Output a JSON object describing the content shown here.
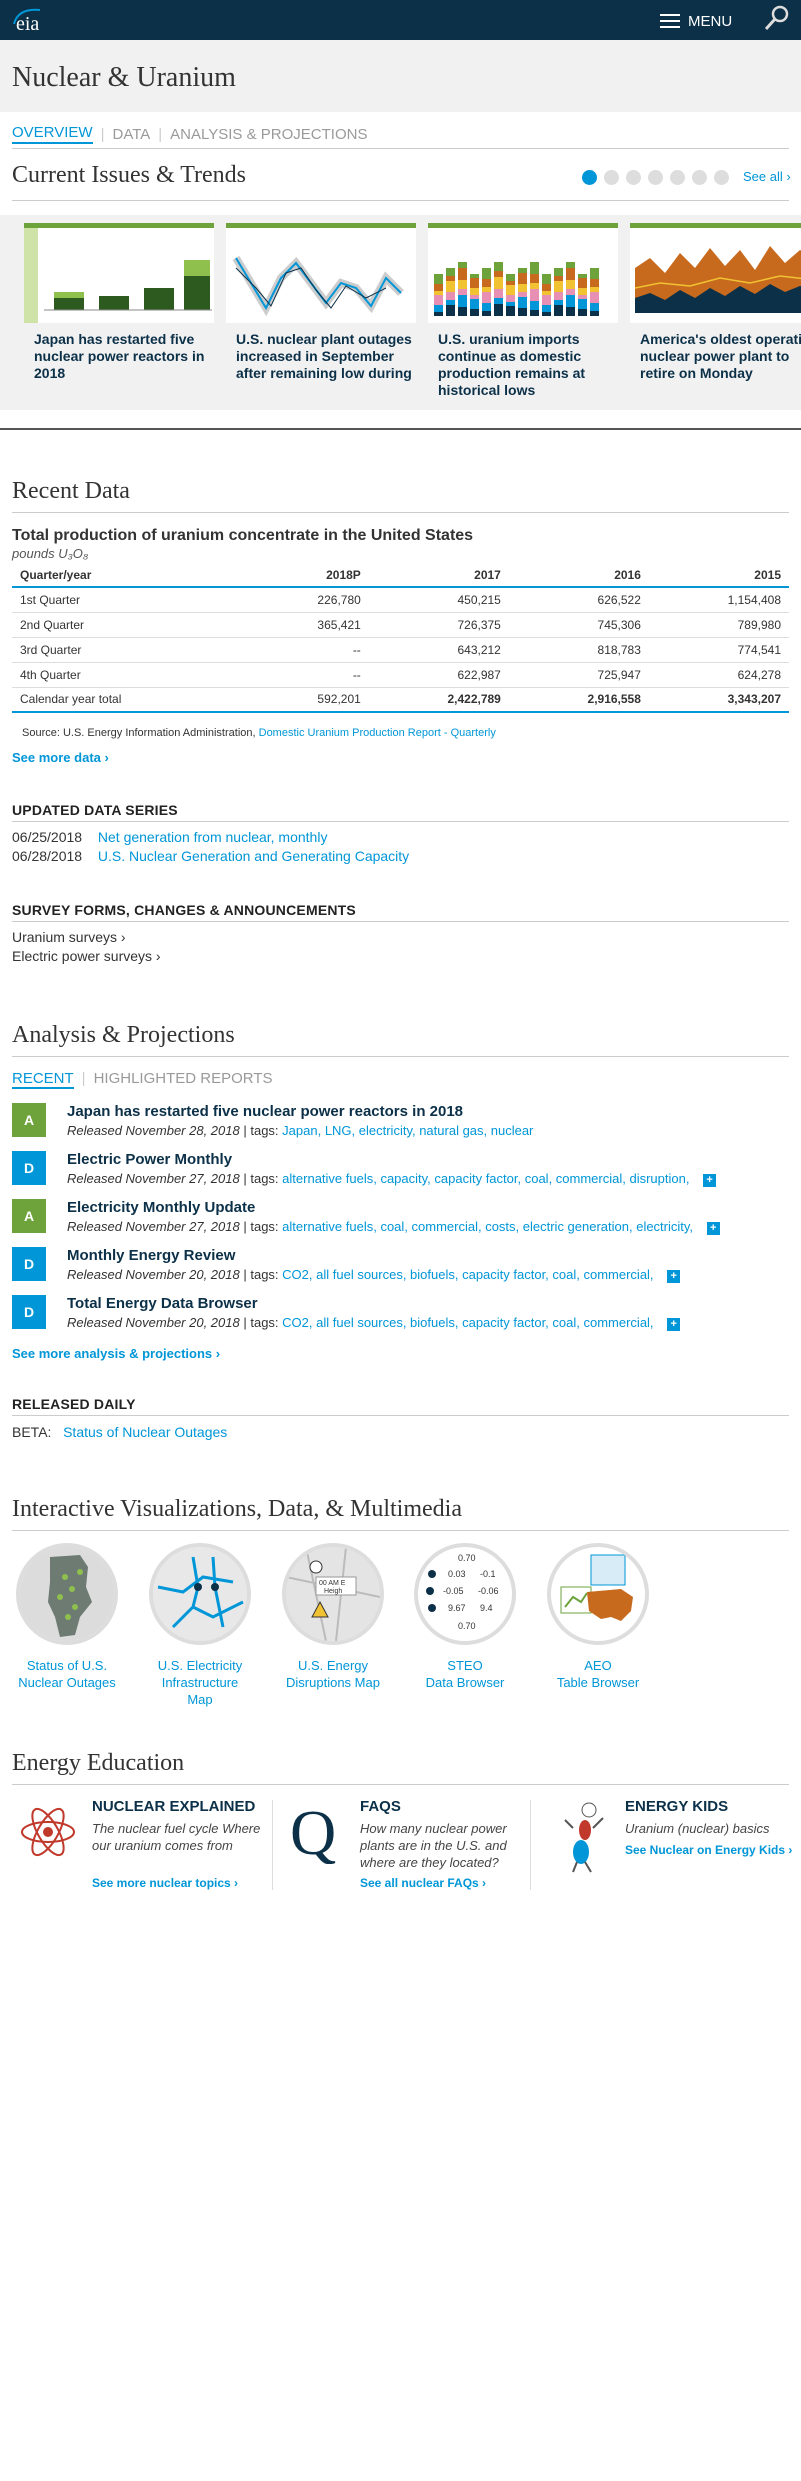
{
  "header": {
    "logo_text": "eia",
    "menu_label": "MENU"
  },
  "page_title": "Nuclear & Uranium",
  "subnav": {
    "overview": "OVERVIEW",
    "data": "DATA",
    "analysis": "ANALYSIS & PROJECTIONS"
  },
  "trends": {
    "title": "Current Issues & Trends",
    "see_all": "See all ›",
    "cards": [
      {
        "caption": "Japan has restarted five nuclear power reactors in 2018"
      },
      {
        "caption": "U.S. nuclear plant outages increased in September after remaining low during"
      },
      {
        "caption": "U.S. uranium imports continue as domestic production remains at historical lows"
      },
      {
        "caption": "America's oldest operating nuclear power plant to retire on Monday"
      }
    ]
  },
  "recent_data": {
    "title": "Recent Data",
    "table_title": "Total production of uranium concentrate in the United States",
    "unit": "pounds U₃O₈",
    "columns": [
      "Quarter/year",
      "2018P",
      "2017",
      "2016",
      "2015"
    ],
    "rows": [
      [
        "1st Quarter",
        "226,780",
        "450,215",
        "626,522",
        "1,154,408"
      ],
      [
        "2nd Quarter",
        "365,421",
        "726,375",
        "745,306",
        "789,980"
      ],
      [
        "3rd Quarter",
        "--",
        "643,212",
        "818,783",
        "774,541"
      ],
      [
        "4th Quarter",
        "--",
        "622,987",
        "725,947",
        "624,278"
      ],
      [
        "Calendar year total",
        "592,201",
        "2,422,789",
        "2,916,558",
        "3,343,207"
      ]
    ],
    "source_prefix": "Source: U.S. Energy Information Administration,",
    "source_link": "Domestic Uranium Production Report - Quarterly",
    "see_more": "See more data ›"
  },
  "updated_series": {
    "title": "UPDATED DATA SERIES",
    "items": [
      {
        "date": "06/25/2018",
        "label": "Net generation from nuclear, monthly"
      },
      {
        "date": "06/28/2018",
        "label": "U.S. Nuclear Generation and Generating Capacity"
      }
    ]
  },
  "survey": {
    "title": "SURVEY FORMS, CHANGES & ANNOUNCEMENTS",
    "items": [
      "Uranium surveys ›",
      "Electric power surveys ›"
    ]
  },
  "analysis": {
    "title": "Analysis & Projections",
    "tab_recent": "RECENT",
    "tab_highlighted": "HIGHLIGHTED REPORTS",
    "reports": [
      {
        "badge": "A",
        "title": "Japan has restarted five nuclear power reactors in 2018",
        "released": "Released November 28, 2018",
        "tags": "Japan, LNG, electricity, natural gas, nuclear",
        "plus": ""
      },
      {
        "badge": "D",
        "title": "Electric Power Monthly",
        "released": "Released November 27, 2018",
        "tags": "alternative fuels, capacity, capacity factor, coal, commercial, disruption,",
        "plus": "+"
      },
      {
        "badge": "A",
        "title": "Electricity Monthly Update",
        "released": "Released November 27, 2018",
        "tags": "alternative fuels, coal, commercial, costs, electric generation, electricity,",
        "plus": "+"
      },
      {
        "badge": "D",
        "title": "Monthly Energy Review",
        "released": "Released November 20, 2018",
        "tags": "CO2, all fuel sources, biofuels, capacity factor, coal, commercial,",
        "plus": "+"
      },
      {
        "badge": "D",
        "title": "Total Energy Data Browser",
        "released": "Released November 20, 2018",
        "tags": "CO2, all fuel sources, biofuels, capacity factor, coal, commercial,",
        "plus": "+"
      }
    ],
    "tags_prefix": "| tags:",
    "see_more": "See more analysis & projections ›"
  },
  "released_daily": {
    "title": "RELEASED DAILY",
    "beta": "BETA:",
    "link": "Status of Nuclear Outages"
  },
  "visualizations": {
    "title": "Interactive Visualizations, Data, & Multimedia",
    "items": [
      {
        "line1": "Status of U.S.",
        "line2": "Nuclear Outages",
        "line3": ""
      },
      {
        "line1": "U.S. Electricity",
        "line2": "Infrastructure",
        "line3": "Map"
      },
      {
        "line1": "U.S. Energy",
        "line2": "Disruptions Map",
        "line3": ""
      },
      {
        "line1": "STEO",
        "line2": "Data Browser",
        "line3": ""
      },
      {
        "line1": "AEO",
        "line2": "Table Browser",
        "line3": ""
      }
    ],
    "steo_values": [
      "0.70",
      "0.03",
      "-0.1",
      "-0.05",
      "-0.06",
      "9.67",
      "9.4",
      "0.70"
    ],
    "disruption_text": "00 AM E",
    "disruption_sub": "Heigh"
  },
  "education": {
    "title": "Energy Education",
    "items": [
      {
        "heading": "NUCLEAR EXPLAINED",
        "body": "The nuclear fuel cycle Where our uranium comes from",
        "link": "See more nuclear topics  ›"
      },
      {
        "heading": "FAQS",
        "body": "How many nuclear power plants are in the U.S. and where are they located?",
        "link": "See all nuclear FAQs  ›"
      },
      {
        "heading": "ENERGY KIDS",
        "body": "Uranium (nuclear) basics",
        "link": "See Nuclear on Energy Kids ›"
      }
    ]
  },
  "colors": {
    "navy": "#0b3048",
    "blue": "#0096d7",
    "green": "#6ea33c"
  }
}
